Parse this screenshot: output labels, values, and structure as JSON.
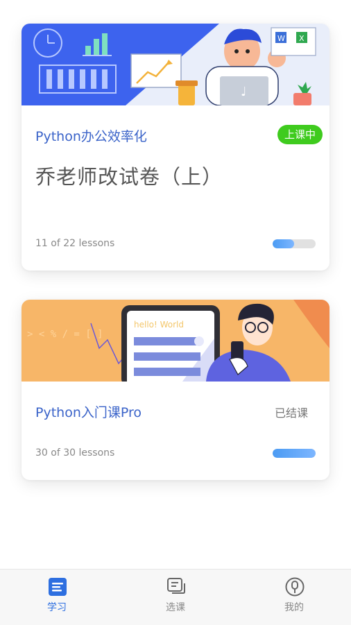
{
  "courses": [
    {
      "course_name": "Python办公效率化",
      "lesson_title": "乔老师改试卷（上）",
      "progress_text": "11 of 22 lessons",
      "status": "上课中",
      "progress": 0.5,
      "banner_icon_labels": [
        "W",
        "X"
      ]
    },
    {
      "course_name": "Python入门课Pro",
      "progress_text": "30 of 30 lessons",
      "status": "已结课",
      "progress": 1.0,
      "banner_text": "hello! World",
      "banner_code_hint": "> < % / = [ ]"
    }
  ],
  "tabbar": {
    "items": [
      {
        "label": "学习",
        "icon": "book-icon",
        "active": true
      },
      {
        "label": "选课",
        "icon": "course-list-icon",
        "active": false
      },
      {
        "label": "我的",
        "icon": "profile-icon",
        "active": false
      }
    ]
  },
  "colors": {
    "accent": "#3a63c9",
    "active_pill": "#3fcb1e",
    "progress_fill": "#4b9bf3",
    "progress_track": "#e1e1e1"
  }
}
